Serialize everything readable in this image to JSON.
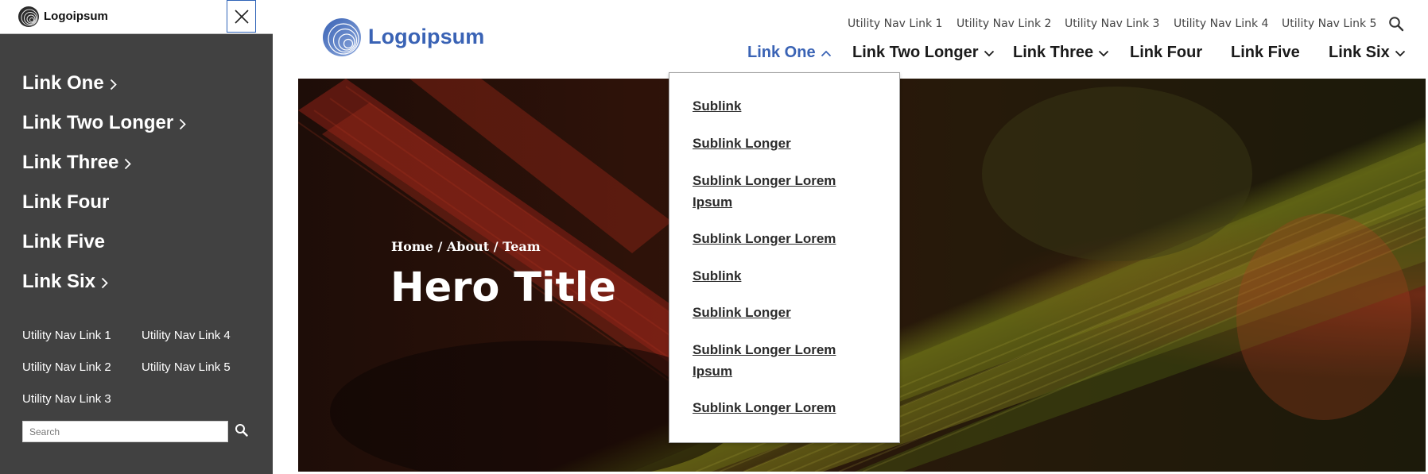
{
  "mobile_menu": {
    "logo_text": "Logoipsum",
    "nav_items": [
      {
        "label": "Link One",
        "has_children": true
      },
      {
        "label": "Link Two Longer",
        "has_children": true
      },
      {
        "label": "Link Three",
        "has_children": true
      },
      {
        "label": "Link Four",
        "has_children": false
      },
      {
        "label": "Link Five",
        "has_children": false
      },
      {
        "label": "Link Six",
        "has_children": true
      }
    ],
    "utility_links": [
      "Utility Nav Link 1",
      "Utility Nav Link 2",
      "Utility Nav Link 3",
      "Utility Nav Link 4",
      "Utility Nav Link 5"
    ],
    "search_placeholder": "Search",
    "icons": {
      "close": "close-icon",
      "search": "search-icon",
      "chevron": "chevron-right-icon"
    }
  },
  "header": {
    "logo_text": "Logoipsum",
    "utility_links": [
      "Utility Nav Link 1",
      "Utility Nav Link 2",
      "Utility Nav Link 3",
      "Utility Nav Link 4",
      "Utility Nav Link 5"
    ],
    "main_nav": [
      {
        "label": "Link One",
        "has_dropdown": true,
        "expanded": true
      },
      {
        "label": "Link Two Longer",
        "has_dropdown": true,
        "expanded": false
      },
      {
        "label": "Link Three",
        "has_dropdown": true,
        "expanded": false
      },
      {
        "label": "Link Four",
        "has_dropdown": false,
        "expanded": false
      },
      {
        "label": "Link Five",
        "has_dropdown": false,
        "expanded": false
      },
      {
        "label": "Link Six",
        "has_dropdown": true,
        "expanded": false
      }
    ]
  },
  "dropdown": {
    "items": [
      "Sublink",
      "Sublink Longer",
      "Sublink Longer Lorem Ipsum",
      "Sublink Longer Lorem",
      "Sublink",
      "Sublink Longer",
      "Sublink Longer Lorem Ipsum",
      "Sublink Longer Lorem"
    ]
  },
  "hero": {
    "breadcrumb": "Home / About / Team",
    "title": "Hero Title"
  },
  "colors": {
    "brand_blue": "#3a63b5",
    "panel_bg": "#414141",
    "active_nav": "#3a63b5"
  }
}
